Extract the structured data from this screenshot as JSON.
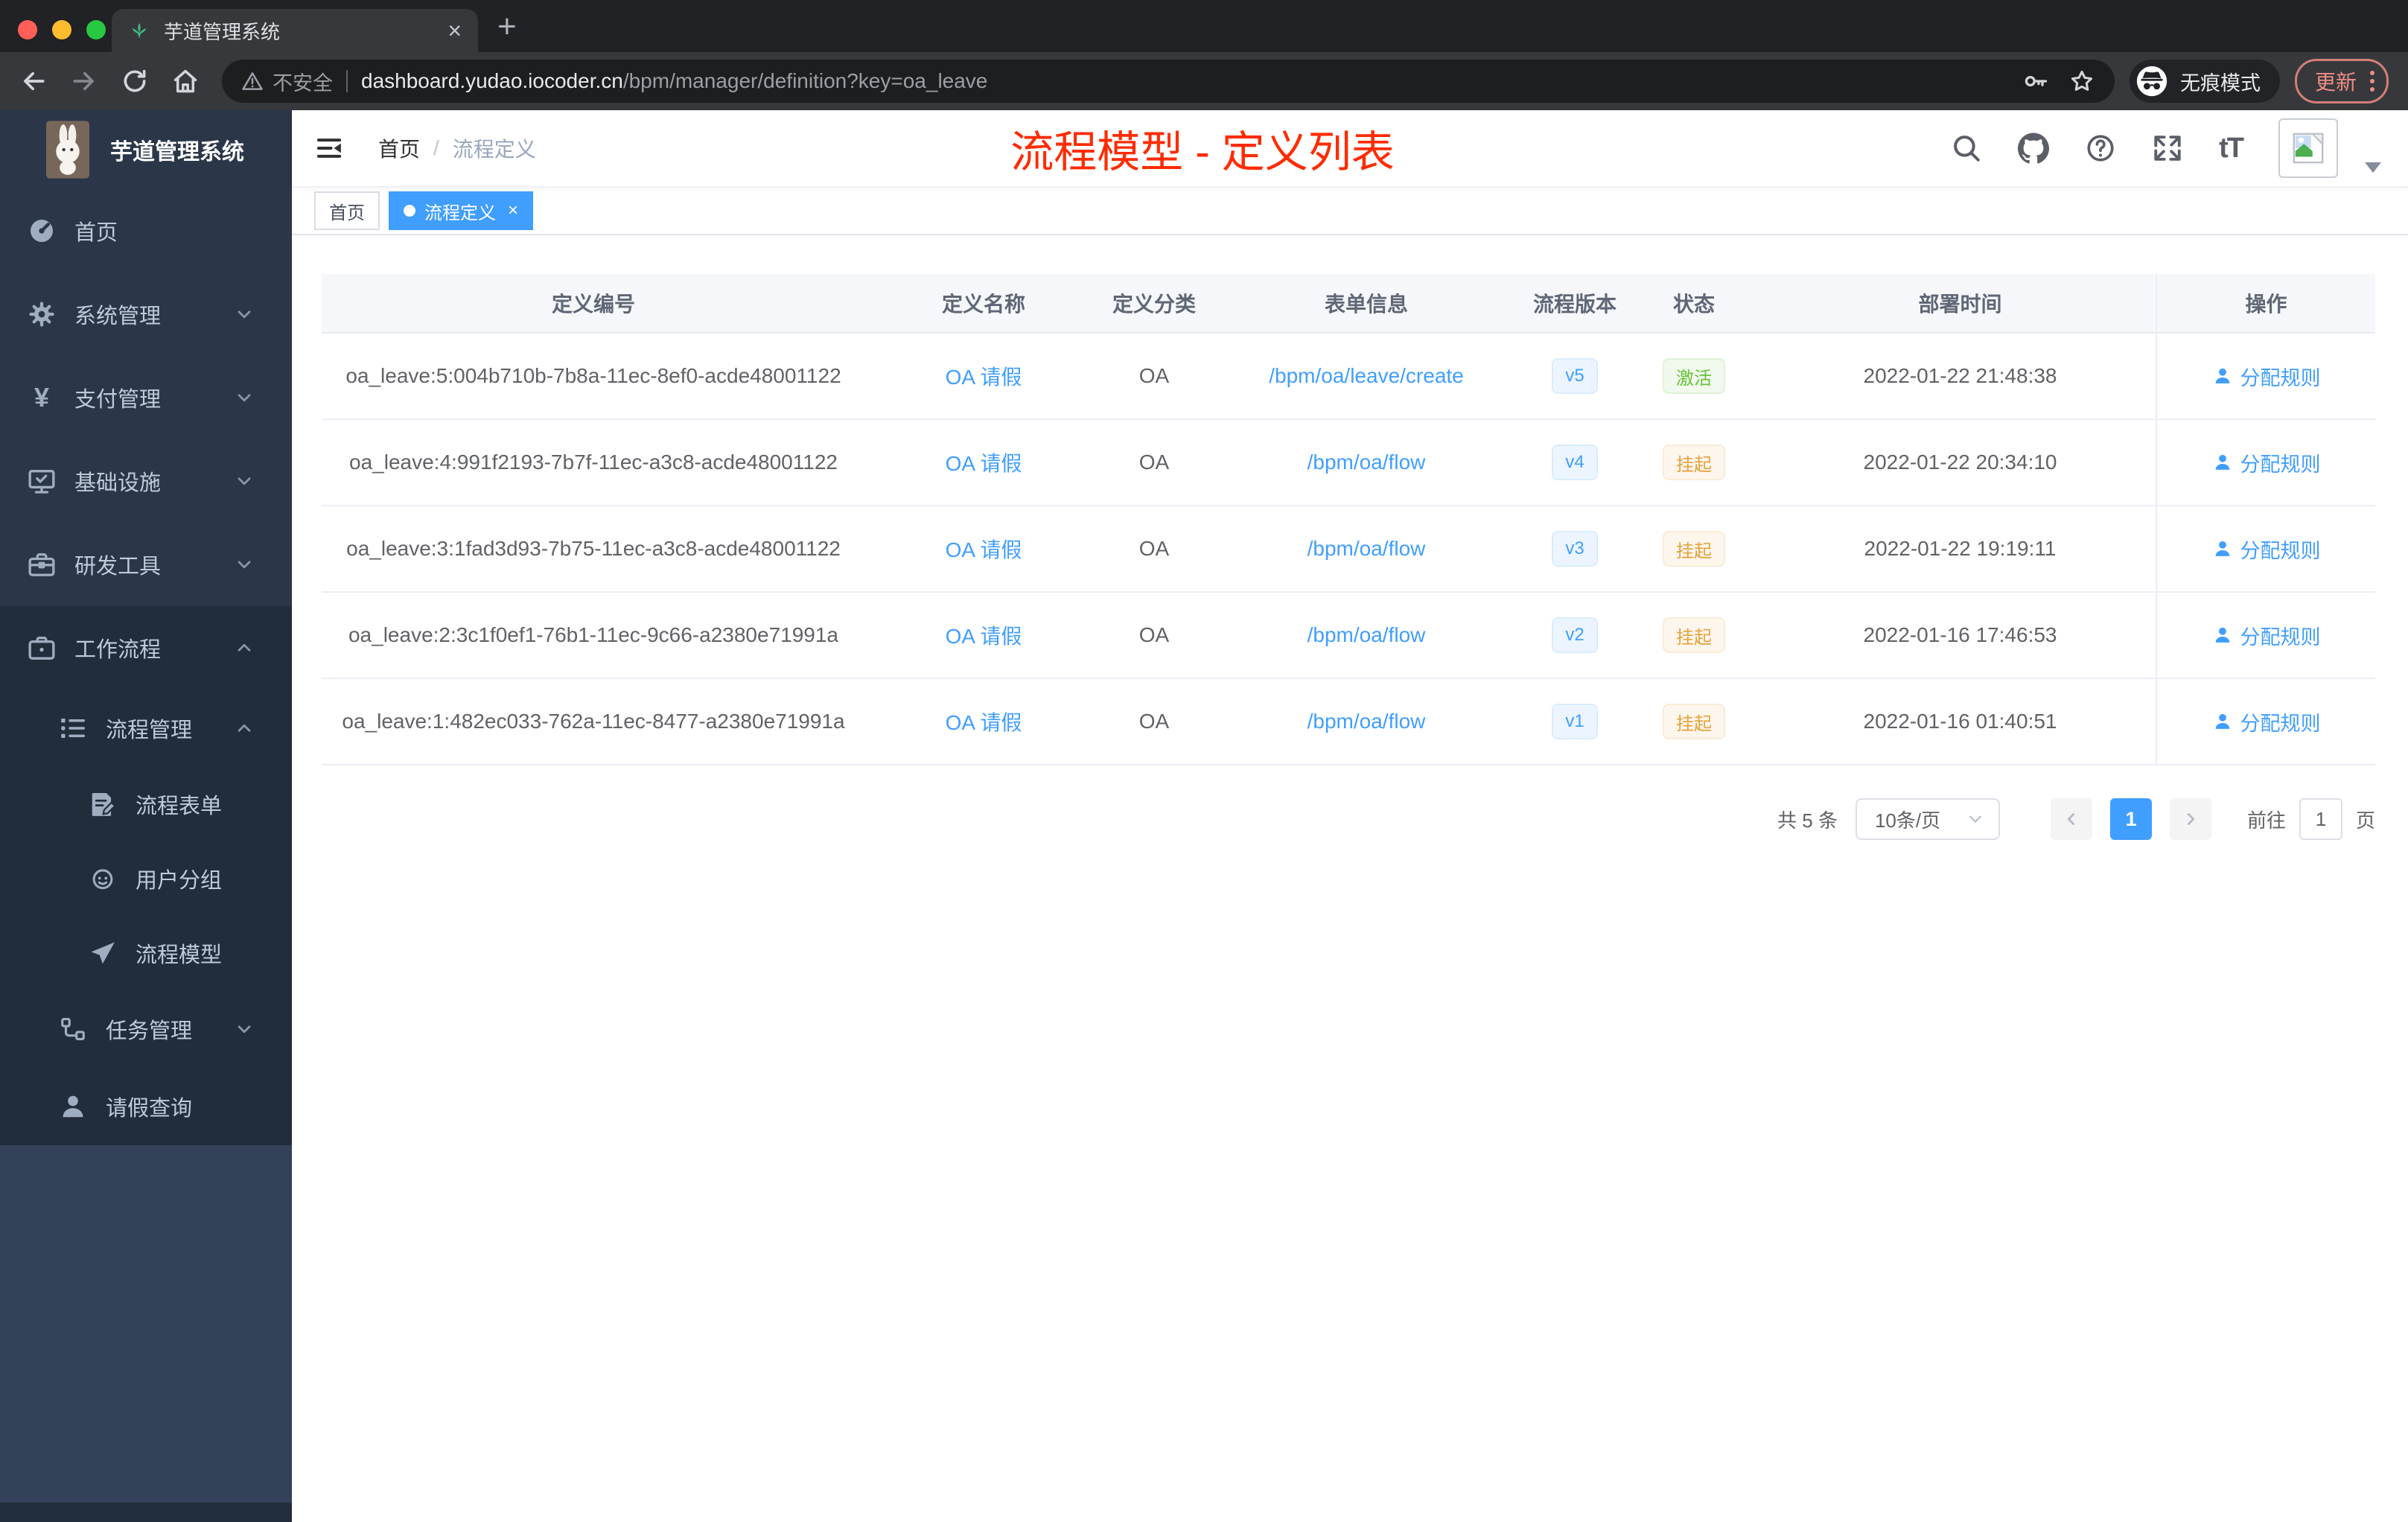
{
  "browser": {
    "tab_title": "芋道管理系统",
    "tab_close_glyph": "×",
    "new_tab_glyph": "+",
    "security_label": "不安全",
    "url_host": "dashboard.yudao.iocoder.cn",
    "url_path": "/bpm/manager/definition?key=oa_leave",
    "incognito_label": "无痕模式",
    "update_label": "更新"
  },
  "sidebar": {
    "app_title": "芋道管理系统",
    "menu": [
      {
        "label": "首页",
        "icon": "dashboard-icon",
        "level": 1
      },
      {
        "label": "系统管理",
        "icon": "gear-icon",
        "level": 1,
        "arrow": "down"
      },
      {
        "label": "支付管理",
        "icon": "yen-icon",
        "level": 1,
        "arrow": "down"
      },
      {
        "label": "基础设施",
        "icon": "monitor-icon",
        "level": 1,
        "arrow": "down"
      },
      {
        "label": "研发工具",
        "icon": "toolbox-icon",
        "level": 1,
        "arrow": "down"
      },
      {
        "label": "工作流程",
        "icon": "briefcase-icon",
        "level": 1,
        "arrow": "up"
      },
      {
        "label": "流程管理",
        "icon": "list-tree-icon",
        "level": 2,
        "arrow": "up"
      },
      {
        "label": "流程表单",
        "icon": "form-edit-icon",
        "level": 3
      },
      {
        "label": "用户分组",
        "icon": "robot-icon",
        "level": 3
      },
      {
        "label": "流程模型",
        "icon": "paper-plane-icon",
        "level": 3
      },
      {
        "label": "任务管理",
        "icon": "tasks-icon",
        "level": 2,
        "arrow": "down"
      },
      {
        "label": "请假查询",
        "icon": "user-icon",
        "level": 2
      }
    ]
  },
  "navbar": {
    "breadcrumb": [
      "首页",
      "流程定义"
    ],
    "breadcrumb_separator": "/",
    "overlay_title": "流程模型 - 定义列表",
    "font_icon_label": "tT"
  },
  "tags": {
    "items": [
      {
        "label": "首页",
        "active": false
      },
      {
        "label": "流程定义",
        "active": true,
        "close_glyph": "×"
      }
    ]
  },
  "table": {
    "columns": [
      "定义编号",
      "定义名称",
      "定义分类",
      "表单信息",
      "流程版本",
      "状态",
      "部署时间",
      "操作"
    ],
    "rows": [
      {
        "id": "oa_leave:5:004b710b-7b8a-11ec-8ef0-acde48001122",
        "name": "OA 请假",
        "category": "OA",
        "form": "/bpm/oa/leave/create",
        "version": "v5",
        "status": "激活",
        "status_type": "active",
        "time": "2022-01-22 21:48:38",
        "action": "分配规则"
      },
      {
        "id": "oa_leave:4:991f2193-7b7f-11ec-a3c8-acde48001122",
        "name": "OA 请假",
        "category": "OA",
        "form": "/bpm/oa/flow",
        "version": "v4",
        "status": "挂起",
        "status_type": "suspended",
        "time": "2022-01-22 20:34:10",
        "action": "分配规则"
      },
      {
        "id": "oa_leave:3:1fad3d93-7b75-11ec-a3c8-acde48001122",
        "name": "OA 请假",
        "category": "OA",
        "form": "/bpm/oa/flow",
        "version": "v3",
        "status": "挂起",
        "status_type": "suspended",
        "time": "2022-01-22 19:19:11",
        "action": "分配规则"
      },
      {
        "id": "oa_leave:2:3c1f0ef1-76b1-11ec-9c66-a2380e71991a",
        "name": "OA 请假",
        "category": "OA",
        "form": "/bpm/oa/flow",
        "version": "v2",
        "status": "挂起",
        "status_type": "suspended",
        "time": "2022-01-16 17:46:53",
        "action": "分配规则"
      },
      {
        "id": "oa_leave:1:482ec033-762a-11ec-8477-a2380e71991a",
        "name": "OA 请假",
        "category": "OA",
        "form": "/bpm/oa/flow",
        "version": "v1",
        "status": "挂起",
        "status_type": "suspended",
        "time": "2022-01-16 01:40:51",
        "action": "分配规则"
      }
    ]
  },
  "pagination": {
    "total": "共 5 条",
    "page_size": "10条/页",
    "current": "1",
    "goto_label": "前往",
    "goto_value": "1",
    "page_unit": "页"
  },
  "colors": {
    "accent": "#409eff",
    "annotation_red": "#fe2b00",
    "status_active": "#67c23a",
    "status_suspended": "#e6a23c",
    "sidebar_bg": "#2b3648",
    "sidebar_submenu_bg": "#222d3c"
  }
}
